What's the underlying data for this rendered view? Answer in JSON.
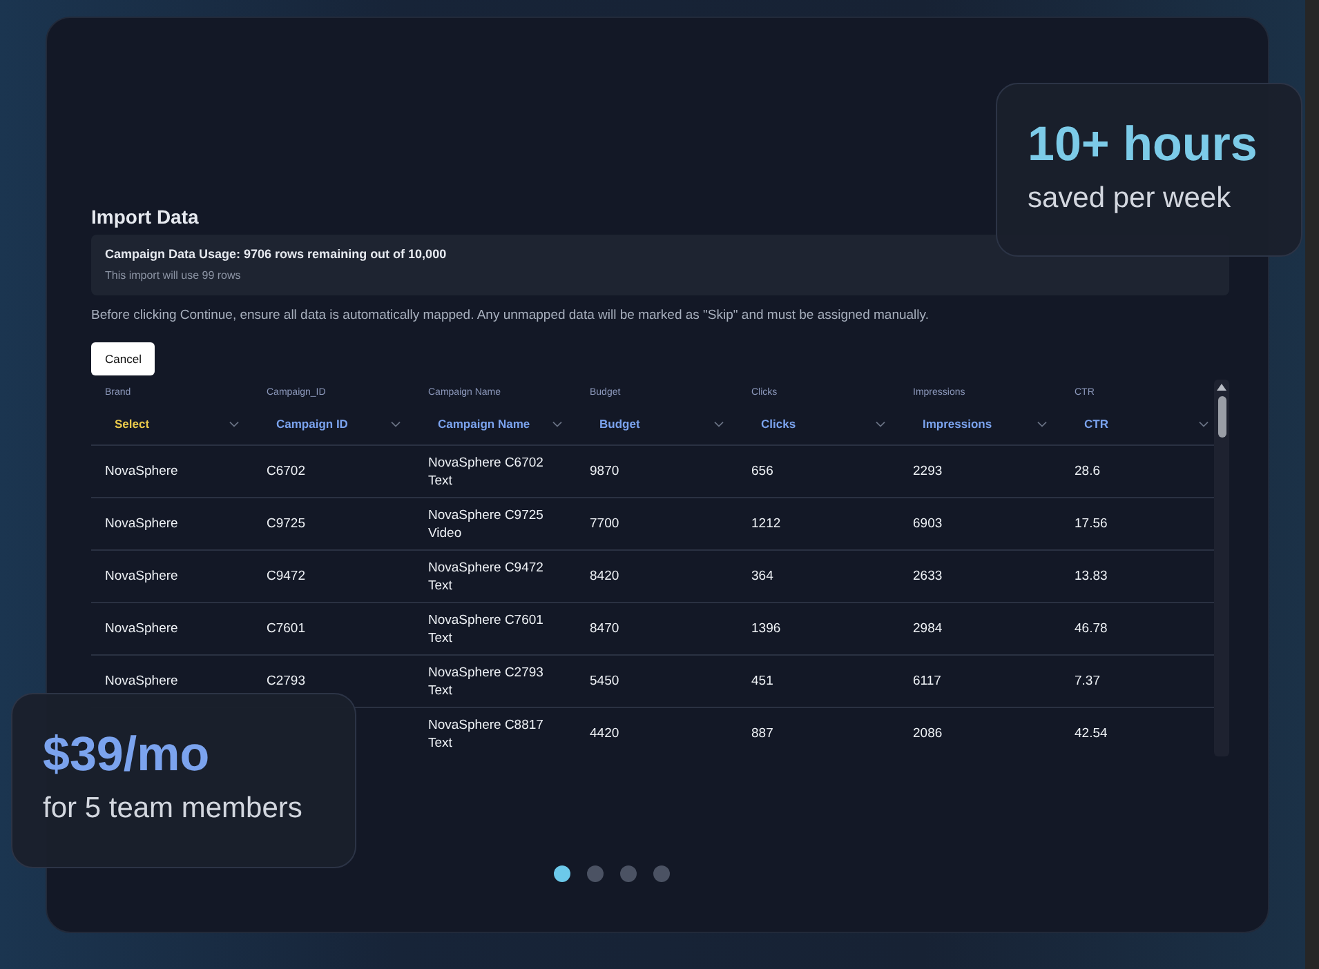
{
  "import_panel": {
    "title": "Import Data",
    "usage": {
      "title": "Campaign Data Usage: 9706 rows remaining out of 10,000",
      "subtitle": "This import will use 99 rows"
    },
    "description": "Before clicking Continue, ensure all data is automatically mapped. Any unmapped data will be marked as \"Skip\" and must be assigned manually.",
    "cancel_button": "Cancel",
    "table": {
      "columns": [
        {
          "label": "Brand",
          "mapping": "Select",
          "mapped": false
        },
        {
          "label": "Campaign_ID",
          "mapping": "Campaign ID",
          "mapped": true
        },
        {
          "label": "Campaign Name",
          "mapping": "Campaign Name",
          "mapped": true
        },
        {
          "label": "Budget",
          "mapping": "Budget",
          "mapped": true
        },
        {
          "label": "Clicks",
          "mapping": "Clicks",
          "mapped": true
        },
        {
          "label": "Impressions",
          "mapping": "Impressions",
          "mapped": true
        },
        {
          "label": "CTR",
          "mapping": "CTR",
          "mapped": true
        }
      ],
      "rows": [
        [
          "NovaSphere",
          "C6702",
          "NovaSphere C6702 Text",
          "9870",
          "656",
          "2293",
          "28.6"
        ],
        [
          "NovaSphere",
          "C9725",
          "NovaSphere C9725 Video",
          "7700",
          "1212",
          "6903",
          "17.56"
        ],
        [
          "NovaSphere",
          "C9472",
          "NovaSphere C9472 Text",
          "8420",
          "364",
          "2633",
          "13.83"
        ],
        [
          "NovaSphere",
          "C7601",
          "NovaSphere C7601 Text",
          "8470",
          "1396",
          "2984",
          "46.78"
        ],
        [
          "NovaSphere",
          "C2793",
          "NovaSphere C2793 Text",
          "5450",
          "451",
          "6117",
          "7.37"
        ],
        [
          null,
          null,
          "NovaSphere C8817 Text",
          "4420",
          "887",
          "2086",
          "42.54"
        ]
      ]
    }
  },
  "stat_cards": [
    {
      "value": "10+ hours",
      "caption": "saved per week",
      "color": "#7ccbe8"
    },
    {
      "value": "$39/mo",
      "caption": "for 5 team members",
      "color": "#7ba3ee"
    }
  ],
  "carousel_dots": [
    {
      "selected": true
    },
    {
      "selected": false
    },
    {
      "selected": false
    },
    {
      "selected": false
    }
  ]
}
